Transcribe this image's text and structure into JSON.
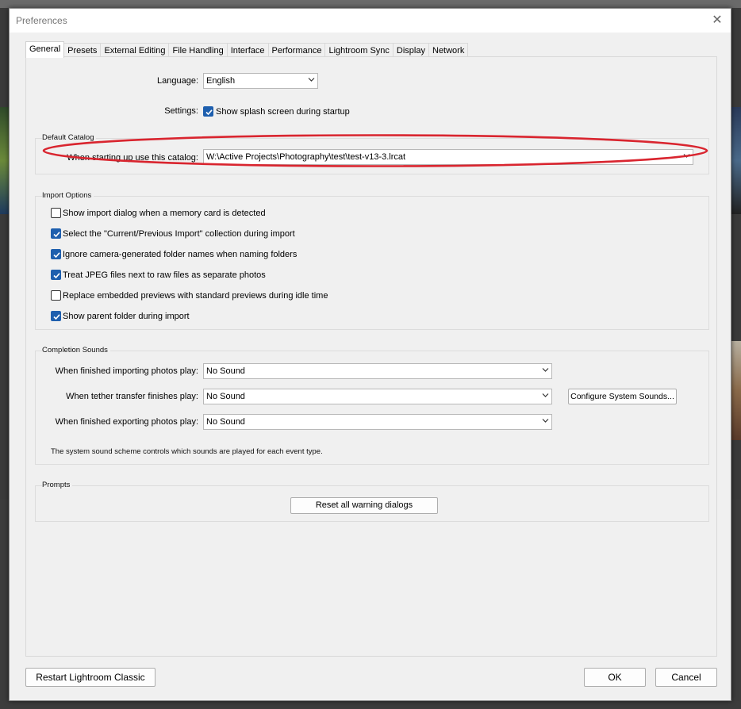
{
  "dialog": {
    "title": "Preferences",
    "close_glyph": "✕"
  },
  "tabs": [
    {
      "label": "General",
      "active": true
    },
    {
      "label": "Presets"
    },
    {
      "label": "External Editing"
    },
    {
      "label": "File Handling"
    },
    {
      "label": "Interface"
    },
    {
      "label": "Performance"
    },
    {
      "label": "Lightroom Sync"
    },
    {
      "label": "Display"
    },
    {
      "label": "Network"
    }
  ],
  "general": {
    "language_label": "Language:",
    "language_value": "English",
    "settings_label": "Settings:",
    "splash_label": "Show splash screen during startup",
    "splash_checked": true
  },
  "default_catalog": {
    "title": "Default Catalog",
    "label": "When starting up use this catalog:",
    "value": "W:\\Active Projects\\Photography\\test\\test-v13-3.lrcat",
    "highlight_color": "#d9252f"
  },
  "import_options": {
    "title": "Import Options",
    "items": [
      {
        "label": "Show import dialog when a memory card is detected",
        "checked": false
      },
      {
        "label": "Select the \"Current/Previous Import\" collection during import",
        "checked": true
      },
      {
        "label": "Ignore camera-generated folder names when naming folders",
        "checked": true
      },
      {
        "label": "Treat JPEG files next to raw files as separate photos",
        "checked": true
      },
      {
        "label": "Replace embedded previews with standard previews during idle time",
        "checked": false
      },
      {
        "label": "Show parent folder during import",
        "checked": true
      }
    ]
  },
  "completion_sounds": {
    "title": "Completion Sounds",
    "importing_label": "When finished importing photos play:",
    "importing_value": "No Sound",
    "tether_label": "When tether transfer finishes play:",
    "tether_value": "No Sound",
    "exporting_label": "When finished exporting photos play:",
    "exporting_value": "No Sound",
    "configure_button": "Configure System Sounds...",
    "note": "The system sound scheme controls which sounds are played for each event type."
  },
  "prompts": {
    "title": "Prompts",
    "reset_button": "Reset all warning dialogs"
  },
  "footer": {
    "restart_button": "Restart Lightroom Classic",
    "ok_button": "OK",
    "cancel_button": "Cancel"
  },
  "colors": {
    "checkbox_accent": "#1e5fae",
    "dialog_bg": "#f0f0f0"
  }
}
